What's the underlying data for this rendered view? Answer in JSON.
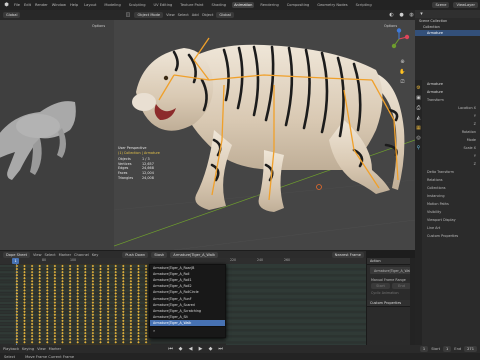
{
  "topbar": {
    "menus": [
      "File",
      "Edit",
      "Render",
      "Window",
      "Help"
    ],
    "workspaces": [
      "Layout",
      "Modeling",
      "Sculpting",
      "UV Editing",
      "Texture Paint",
      "Shading",
      "Animation",
      "Rendering",
      "Compositing",
      "Geometry Nodes",
      "Scripting"
    ],
    "active_workspace": "Animation",
    "scene_label": "Scene",
    "view_layer_label": "ViewLayer"
  },
  "viewport_header": {
    "mode": "Object Mode",
    "menus": [
      "View",
      "Select",
      "Add",
      "Object"
    ],
    "left_mode": "Global",
    "options": "Options"
  },
  "left_viewport": {
    "options": "Options"
  },
  "main_viewport": {
    "perspective": "User Perspective",
    "collection": "(1) Collection | Armature",
    "stats": [
      {
        "label": "Objects",
        "value": "1 / 3"
      },
      {
        "label": "Vertices",
        "value": "12,657"
      },
      {
        "label": "Edges",
        "value": "24,668"
      },
      {
        "label": "Faces",
        "value": "12,004"
      },
      {
        "label": "Triangles",
        "value": "24,008"
      }
    ]
  },
  "outliner": {
    "rows": [
      {
        "label": "Scene Collection",
        "selected": false
      },
      {
        "label": "Collection",
        "selected": false
      },
      {
        "label": "Armature",
        "selected": true
      }
    ]
  },
  "properties": {
    "object_name": "Armature",
    "object_name2": "Armature",
    "sections": [
      "Transform",
      "Location X",
      "Y",
      "Z",
      "Rotation",
      "Mode",
      "Scale X",
      "Y",
      "Z",
      "Delta Transform",
      "Relations",
      "Collections",
      "Instancing",
      "Motion Paths",
      "Visibility",
      "Viewport Display",
      "Line Art",
      "Custom Properties"
    ]
  },
  "dopesheet": {
    "menus": [
      "View",
      "Select",
      "Marker",
      "Channel",
      "Key"
    ],
    "mode": "Dope Sheet",
    "action_label": "Action",
    "push_down": "Push Down",
    "stash": "Stash",
    "current_frame": "1",
    "frame_marks": [
      "80",
      "100",
      "120",
      "140",
      "160",
      "180",
      "200",
      "220",
      "240",
      "260"
    ],
    "nearest_frame": "Nearest Frame"
  },
  "action_dropdown": {
    "items": [
      "Armature|Tiger_A_Roar|B",
      "Armature|Tiger_A_Roll",
      "Armature|Tiger_A_Roll1",
      "Armature|Tiger_A_Roll2",
      "Armature|Tiger_A_RollCircle",
      "Armature|Tiger_A_RunF",
      "Armature|Tiger_A_Scared",
      "Armature|Tiger_A_Scratching",
      "Armature|Tiger_A_Sit",
      "Armature|Tiger_A_Walk"
    ],
    "selected_index": 9,
    "current": "Armature|Tiger_A_Walk",
    "search_glyph": "⌕"
  },
  "npanel": {
    "section": "Action",
    "action_name": "Armature|Tiger_A_Walk",
    "manual_frame_range": "Manual Frame Range",
    "start_label": "Start",
    "end_label": "End",
    "cyclic": "Cyclic Animation",
    "custom_props": "Custom Properties"
  },
  "bottom_bar": {
    "left_items": [
      "Playback",
      "Keying",
      "View",
      "Marker"
    ],
    "status_left": "Select",
    "status_mid": "Move Frame Current Frame",
    "current": "1",
    "start_label": "Start",
    "start": "1",
    "end_label": "End",
    "end": "271"
  },
  "colors": {
    "accent": "#4772b3",
    "keyframe": "#e3b23c",
    "bone": "#f0a02a",
    "grid_green": "#6e9d2e"
  }
}
